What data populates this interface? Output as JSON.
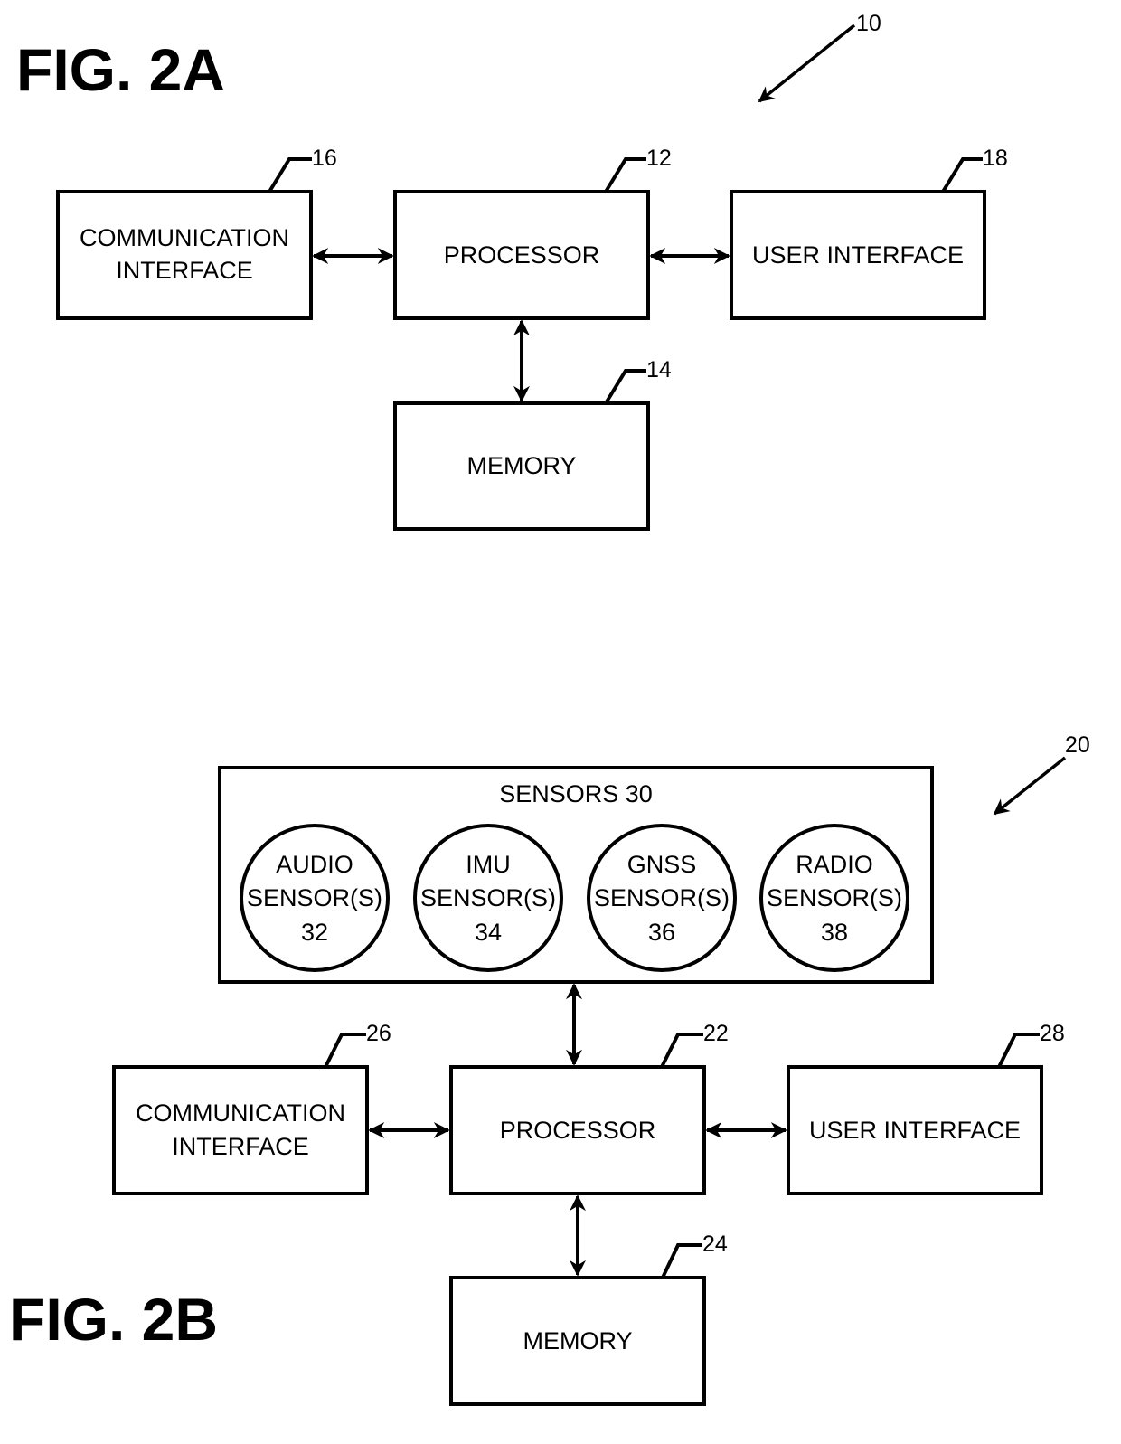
{
  "figure_a": {
    "title": "FIG. 2A",
    "ref": "10",
    "processor": {
      "label": "PROCESSOR",
      "ref": "12"
    },
    "memory": {
      "label": "MEMORY",
      "ref": "14"
    },
    "communication_interface": {
      "label_line1": "COMMUNICATION",
      "label_line2": "INTERFACE",
      "ref": "16"
    },
    "user_interface": {
      "label": "USER INTERFACE",
      "ref": "18"
    }
  },
  "figure_b": {
    "title": "FIG. 2B",
    "ref": "20",
    "processor": {
      "label": "PROCESSOR",
      "ref": "22"
    },
    "memory": {
      "label": "MEMORY",
      "ref": "24"
    },
    "communication_interface": {
      "label_line1": "COMMUNICATION",
      "label_line2": "INTERFACE",
      "ref": "26"
    },
    "user_interface": {
      "label": "USER INTERFACE",
      "ref": "28"
    },
    "sensors": {
      "label": "SENSORS 30",
      "items": [
        {
          "line1": "AUDIO",
          "line2": "SENSOR(S)",
          "ref": "32"
        },
        {
          "line1": "IMU",
          "line2": "SENSOR(S)",
          "ref": "34"
        },
        {
          "line1": "GNSS",
          "line2": "SENSOR(S)",
          "ref": "36"
        },
        {
          "line1": "RADIO",
          "line2": "SENSOR(S)",
          "ref": "38"
        }
      ]
    }
  }
}
